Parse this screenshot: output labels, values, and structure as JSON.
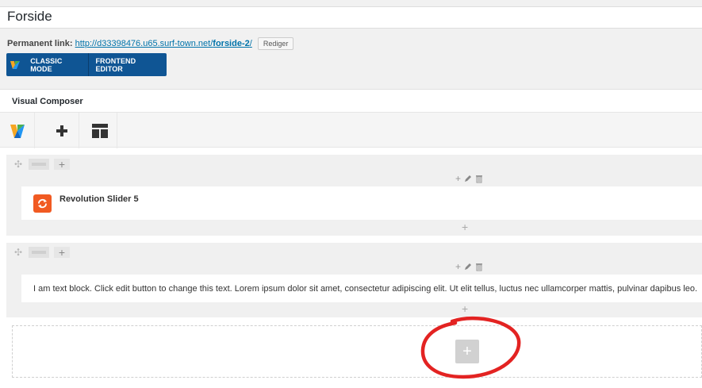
{
  "page": {
    "title": "Forside"
  },
  "permalink": {
    "label": "Permanent link:",
    "url_prefix": "http://d33398476.u65.surf-town.net/",
    "url_slug": "forside-2",
    "url_suffix": "/",
    "edit_label": "Rediger"
  },
  "mode_bar": {
    "classic_label": "CLASSIC MODE",
    "frontend_label": "FRONTEND EDITOR",
    "color": "#0f5594"
  },
  "composer": {
    "title": "Visual Composer",
    "toolbar": {
      "logo_icon": "vc-logo-icon",
      "add_icon": "plus-icon",
      "templates_icon": "templates-icon"
    }
  },
  "rows": [
    {
      "element_name": "Revolution Slider 5",
      "element_icon": "revolution-slider-icon",
      "add_symbol": "+",
      "column_controls": "+"
    },
    {
      "text": "I am text block. Click edit button to change this text. Lorem ipsum dolor sit amet, consectetur adipiscing elit. Ut elit tellus, luctus nec ullamcorper mattis, pulvinar dapibus leo.",
      "add_symbol": "+",
      "column_controls": "+"
    }
  ],
  "empty_row": {
    "add_symbol": "+"
  },
  "colors": {
    "accent": "#0073aa",
    "slider_icon": "#f15a22",
    "highlight_circle": "#e32322"
  }
}
